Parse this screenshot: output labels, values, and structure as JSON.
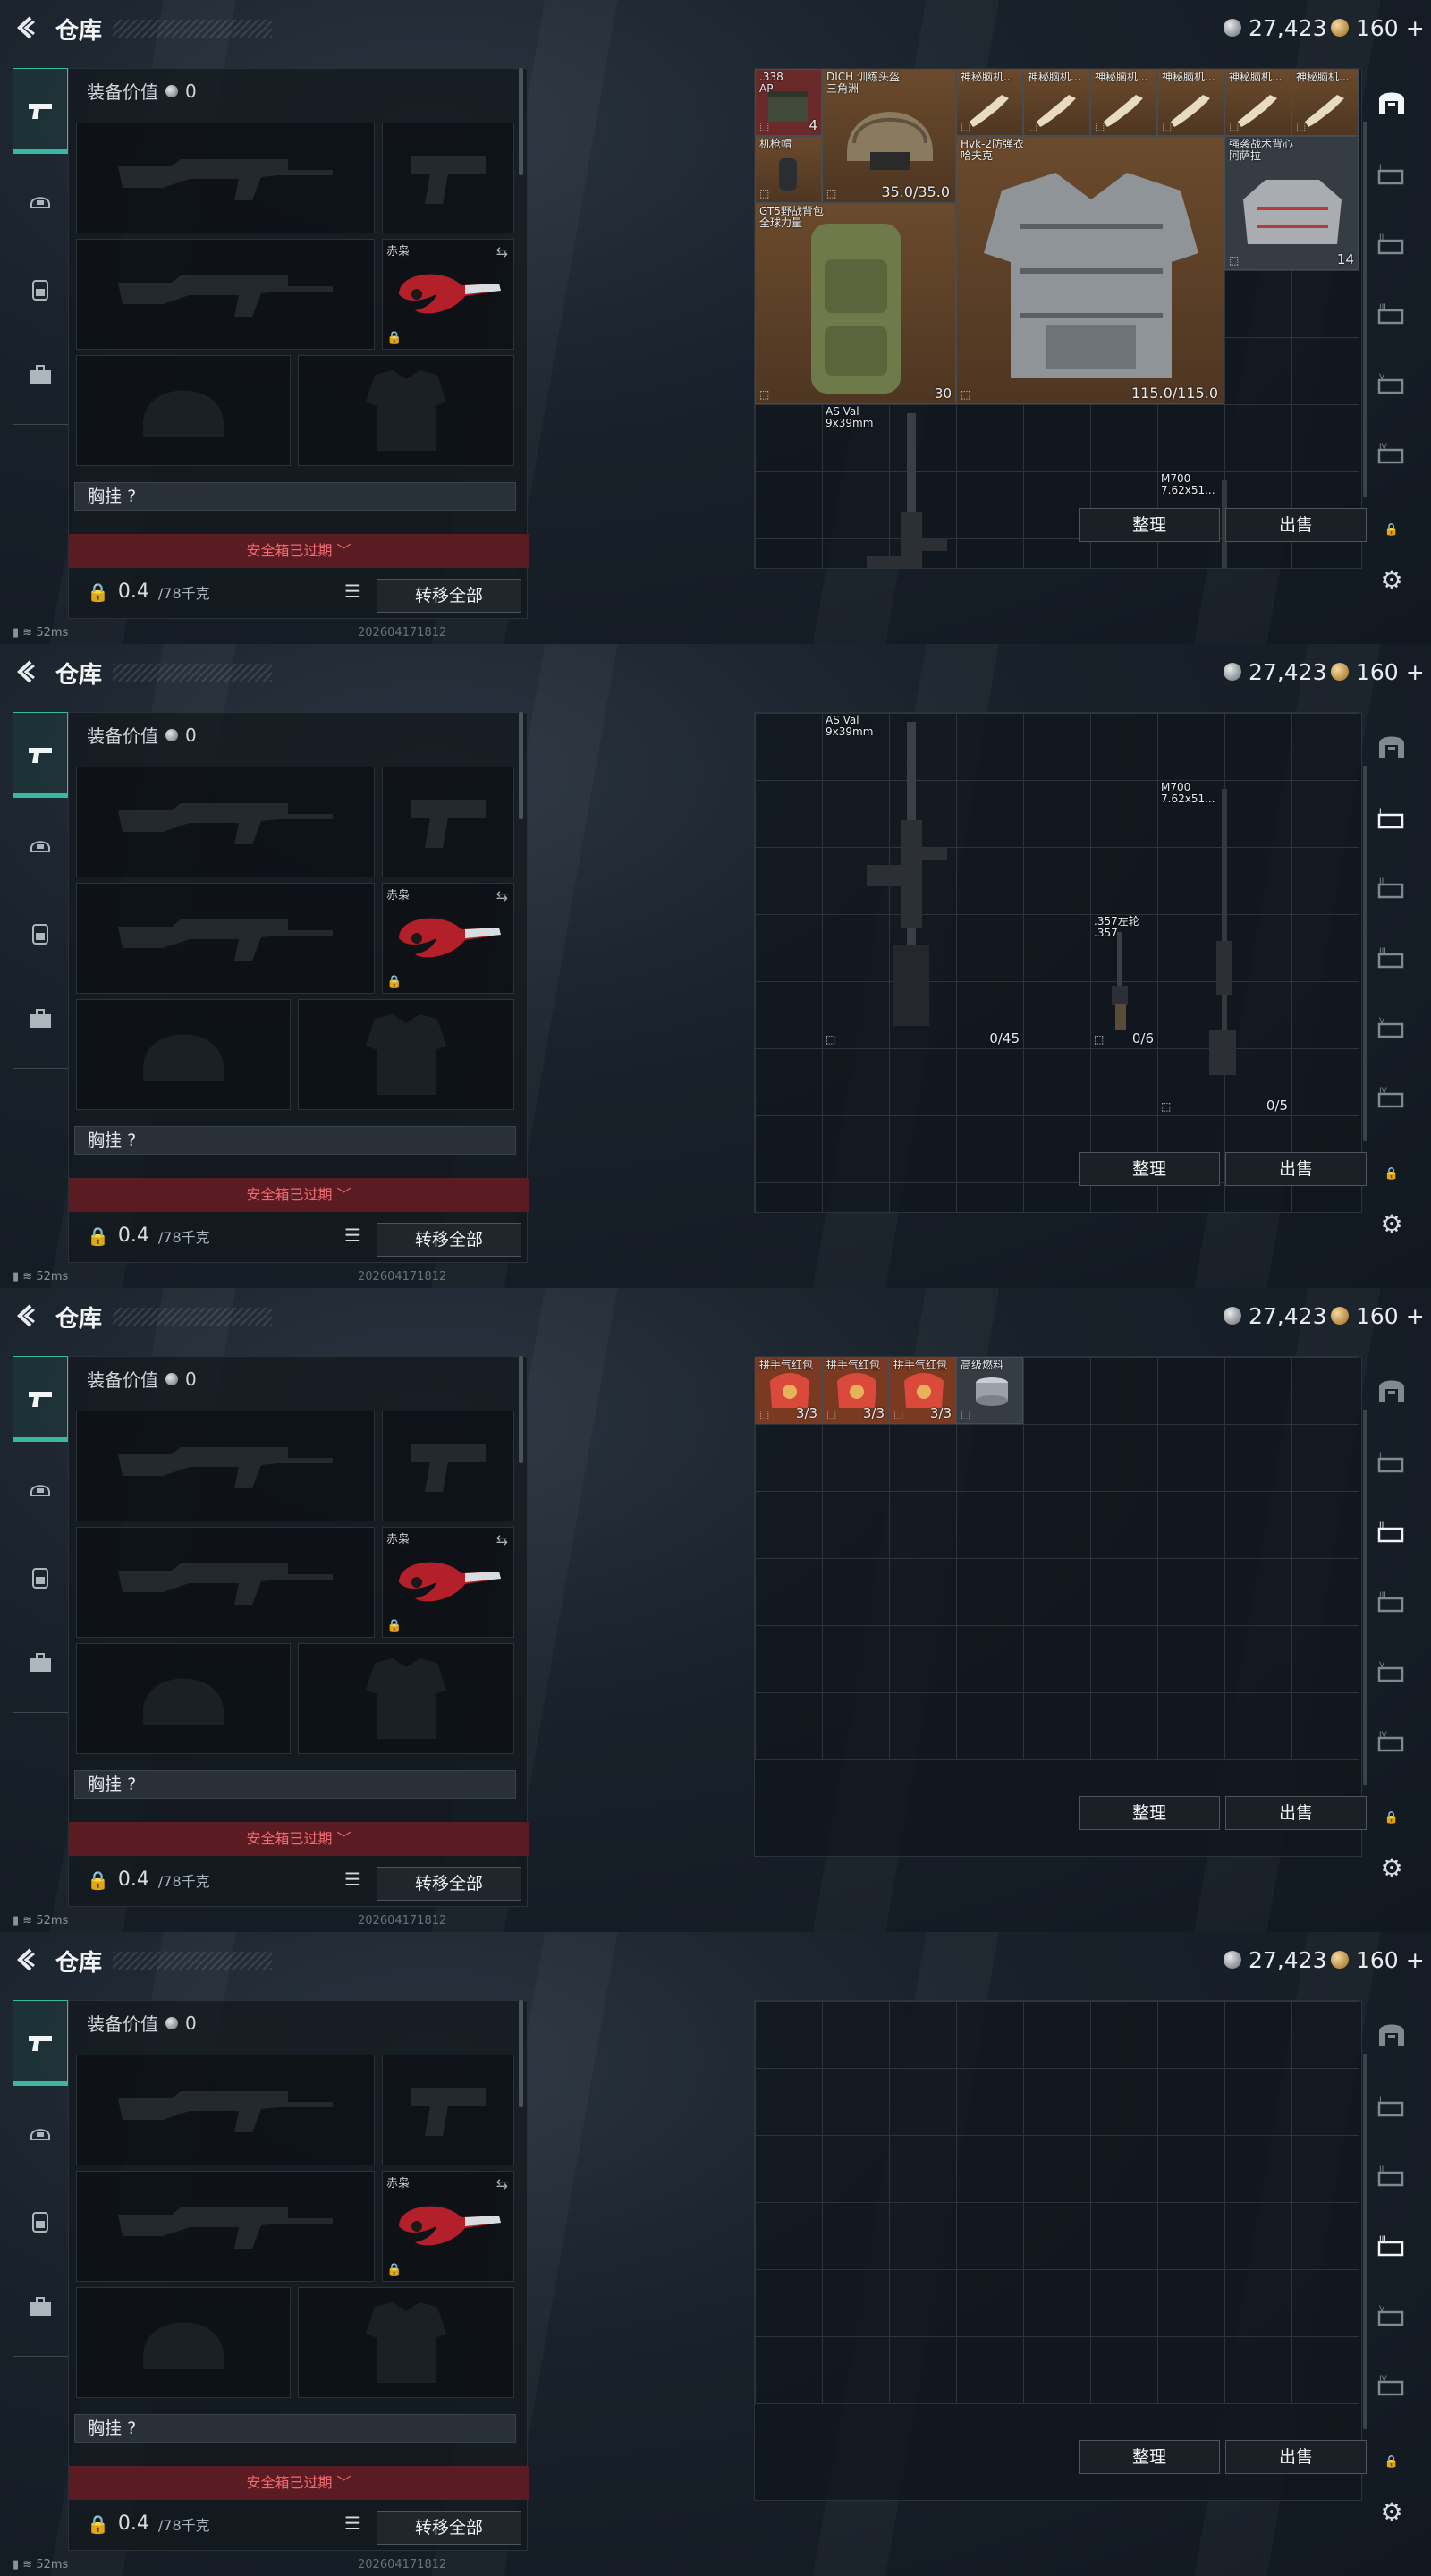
{
  "header": {
    "title": "仓库",
    "silver": "27,423",
    "gold": "160",
    "plus": "+"
  },
  "equipment": {
    "value_label": "装备价值",
    "value": "0",
    "knife_label": "赤枭",
    "chest_label": "胸挂",
    "chest_q": "?",
    "safebox": "安全箱已过期 ﹀",
    "weight": "0.4",
    "weight_unit": "/78千克",
    "transfer": "转移全部"
  },
  "actions": {
    "sort": "整理",
    "sell": "出售"
  },
  "status": {
    "ping": "52ms",
    "build": "202604171812"
  },
  "frames": [
    {
      "items": [
        {
          "name": ".338\nAP",
          "qty": "4"
        },
        {
          "name": "DICH 训练头盔\n三角洲",
          "dur": "35.0/35.0"
        },
        {
          "name": "神秘脑机..."
        },
        {
          "name": "神秘脑机..."
        },
        {
          "name": "神秘脑机..."
        },
        {
          "name": "神秘脑机..."
        },
        {
          "name": "神秘脑机..."
        },
        {
          "name": "神秘脑机..."
        },
        {
          "name": "机枪帽"
        },
        {
          "name": "Hvk-2防弹衣\n哈夫克",
          "dur": "115.0/115.0"
        },
        {
          "name": "强袭战术背心\n阿萨拉",
          "qty": "14"
        },
        {
          "name": "GT5野战背包\n全球力量",
          "qty": "30"
        },
        {
          "name": "AS Val\n9x39mm"
        },
        {
          "name": "M700\n7.62x51..."
        }
      ]
    },
    {
      "items": [
        {
          "name": "AS Val\n9x39mm",
          "qty": "0/45"
        },
        {
          "name": ".357左轮\n.357",
          "qty": "0/6"
        },
        {
          "name": "M700\n7.62x51...",
          "qty": "0/5"
        }
      ]
    },
    {
      "items": [
        {
          "name": "拼手气红包",
          "qty": "3/3"
        },
        {
          "name": "拼手气红包",
          "qty": "3/3"
        },
        {
          "name": "拼手气红包",
          "qty": "3/3"
        },
        {
          "name": "高级燃料"
        }
      ]
    },
    {
      "items": []
    }
  ],
  "colors": {
    "accent": "#3ab7a0",
    "safebox_bg": "#5a1c22",
    "safebox_text": "#f06a70"
  },
  "icons": [
    "back-arrow-icon",
    "silver-coin-icon",
    "gold-coin-icon",
    "pistol-icon",
    "helmet-icon",
    "backpack-icon",
    "briefcase-icon",
    "lock-icon",
    "list-icon",
    "swap-icon",
    "gear-icon",
    "arch-icon"
  ]
}
